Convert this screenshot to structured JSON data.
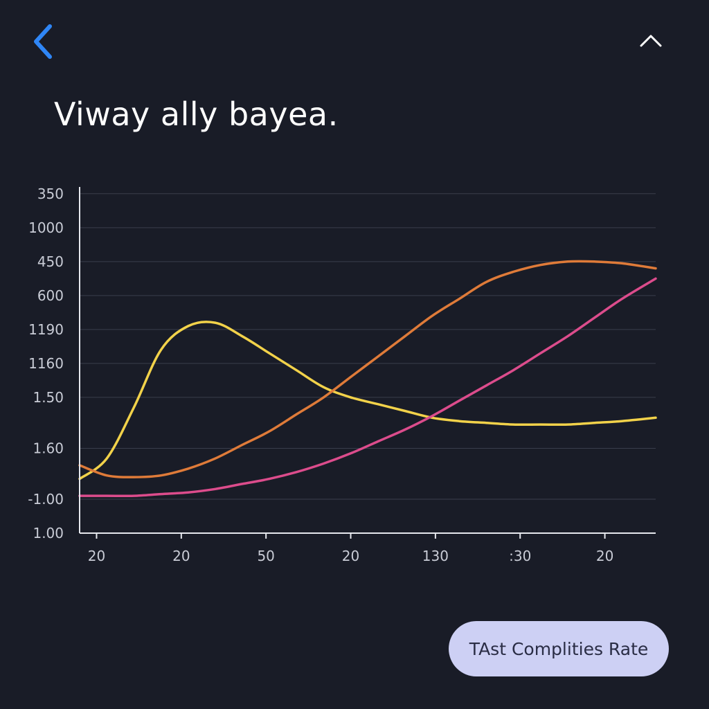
{
  "header": {
    "back_icon": "chevron-left-icon",
    "collapse_icon": "chevron-up-icon",
    "title": "Viway ally bayea."
  },
  "colors": {
    "background": "#191c27",
    "accent": "#2f86f6",
    "grid": "#3a3e4c",
    "axis": "#e6e8ee",
    "yellow_series": "#f2d24a",
    "orange_series": "#df7b39",
    "pink_series": "#dc4c8c",
    "pill_background": "#cdd0f4",
    "pill_text": "#2a2d45"
  },
  "legend_button": {
    "label": "TAst Complities Rate"
  },
  "chart_data": {
    "type": "line",
    "title": "",
    "xlabel": "",
    "ylabel": "",
    "grid": true,
    "x_tick_labels": [
      "20",
      "20",
      "50",
      "20",
      "130",
      ":30",
      "20"
    ],
    "x_tick_positions": [
      0.5,
      3,
      5.5,
      8,
      10.5,
      13,
      15.5
    ],
    "xlim": [
      0,
      17
    ],
    "y_tick_labels": [
      "1.00",
      "-1.00",
      "1.60",
      "1.50",
      "1160",
      "1190",
      "600",
      "450",
      "1000",
      "350"
    ],
    "y_tick_positions": [
      0,
      1,
      2.5,
      4,
      5,
      6,
      7,
      8,
      9,
      10
    ],
    "ylim": [
      0,
      10.2
    ],
    "series": [
      {
        "color": "#f2d24a",
        "x": [
          0,
          0.8,
          1.6,
          2.4,
          3.2,
          4.0,
          4.8,
          5.6,
          6.4,
          7.2,
          8.0,
          8.8,
          9.6,
          10.4,
          11.2,
          12.0,
          12.8,
          13.6,
          14.4,
          15.2,
          16.0,
          17.0
        ],
        "y": [
          1.6,
          2.2,
          3.7,
          5.4,
          6.1,
          6.2,
          5.8,
          5.3,
          4.8,
          4.3,
          4.0,
          3.8,
          3.6,
          3.4,
          3.3,
          3.25,
          3.2,
          3.2,
          3.2,
          3.25,
          3.3,
          3.4
        ]
      },
      {
        "color": "#df7b39",
        "x": [
          0,
          0.8,
          1.6,
          2.4,
          3.2,
          4.0,
          4.8,
          5.6,
          6.4,
          7.2,
          8.0,
          8.8,
          9.6,
          10.4,
          11.2,
          12.0,
          12.8,
          13.6,
          14.4,
          15.2,
          16.0,
          17.0
        ],
        "y": [
          2.0,
          1.7,
          1.65,
          1.7,
          1.9,
          2.2,
          2.6,
          3.0,
          3.5,
          4.0,
          4.6,
          5.2,
          5.8,
          6.4,
          6.9,
          7.4,
          7.7,
          7.9,
          8.0,
          8.0,
          7.95,
          7.8
        ]
      },
      {
        "color": "#dc4c8c",
        "x": [
          0,
          0.8,
          1.6,
          2.4,
          3.2,
          4.0,
          4.8,
          5.6,
          6.4,
          7.2,
          8.0,
          8.8,
          9.6,
          10.4,
          11.2,
          12.0,
          12.8,
          13.6,
          14.4,
          15.2,
          16.0,
          17.0
        ],
        "y": [
          1.1,
          1.1,
          1.1,
          1.15,
          1.2,
          1.3,
          1.45,
          1.6,
          1.8,
          2.05,
          2.35,
          2.7,
          3.05,
          3.45,
          3.9,
          4.35,
          4.8,
          5.3,
          5.8,
          6.35,
          6.9,
          7.5
        ]
      }
    ]
  }
}
